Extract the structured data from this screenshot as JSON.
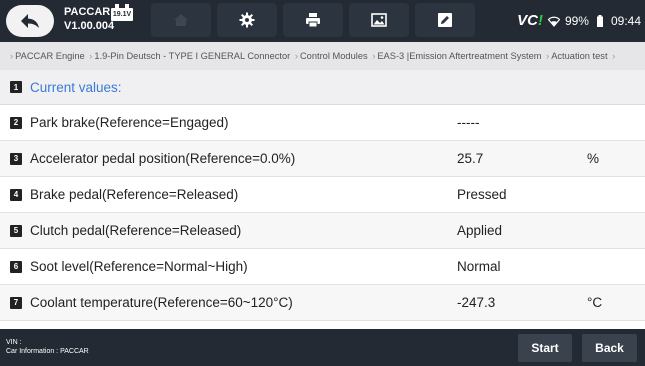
{
  "header": {
    "app_name": "PACCAR",
    "version": "V1.00.004",
    "voltage": "19.1V",
    "vci_label": "VC",
    "battery": "99%",
    "time": "09:44",
    "tabs": [
      "home-icon",
      "gear-icon",
      "printer-icon",
      "image-icon",
      "edit-icon"
    ]
  },
  "breadcrumb": [
    "PACCAR Engine",
    "1.9-Pin Deutsch - TYPE I GENERAL Connector",
    "Control Modules",
    "EAS-3 |Emission Aftertreatment System",
    "Actuation test"
  ],
  "table": {
    "header": {
      "num": "1",
      "label": "Current values:"
    },
    "rows": [
      {
        "num": "2",
        "label": "Park brake(Reference=Engaged)",
        "value": "-----",
        "unit": ""
      },
      {
        "num": "3",
        "label": "Accelerator pedal position(Reference=0.0%)",
        "value": "25.7",
        "unit": "%"
      },
      {
        "num": "4",
        "label": "Brake pedal(Reference=Released)",
        "value": "Pressed",
        "unit": ""
      },
      {
        "num": "5",
        "label": "Clutch pedal(Reference=Released)",
        "value": "Applied",
        "unit": ""
      },
      {
        "num": "6",
        "label": "Soot level(Reference=Normal~High)",
        "value": "Normal",
        "unit": ""
      },
      {
        "num": "7",
        "label": "Coolant temperature(Reference=60~120°C)",
        "value": "-247.3",
        "unit": "°C"
      }
    ]
  },
  "footer": {
    "vin": "VIN :",
    "car_info": "Car Information : PACCAR",
    "start_label": "Start",
    "back_label": "Back"
  }
}
